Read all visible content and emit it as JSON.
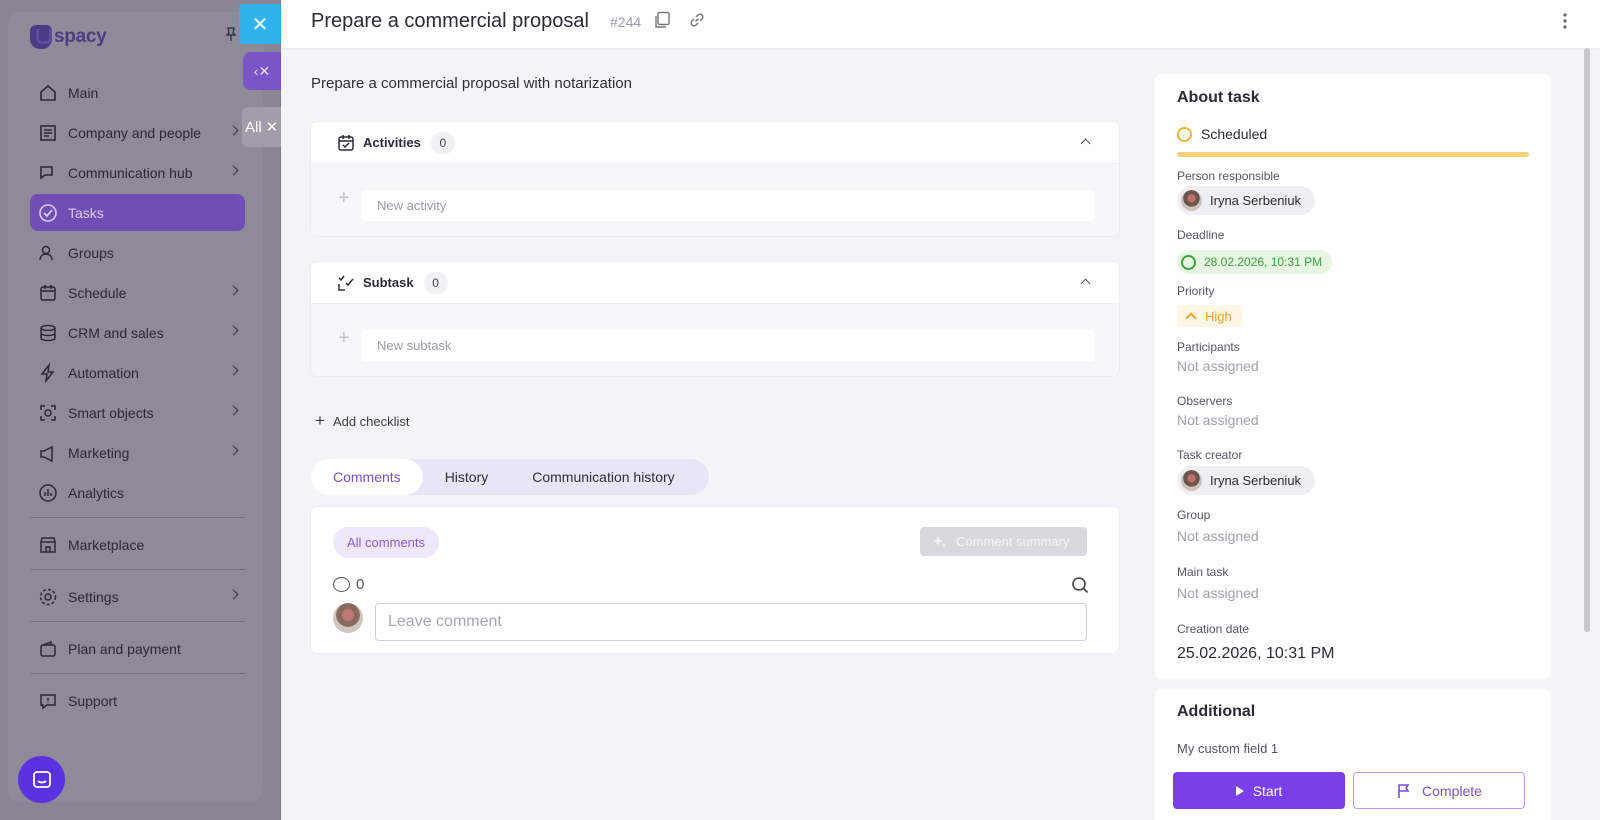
{
  "sidebar": {
    "logo_text": "spacy",
    "items": [
      {
        "label": "Main",
        "icon": "home-icon",
        "has_arrow": false
      },
      {
        "label": "Company and people",
        "icon": "company-icon",
        "has_arrow": true
      },
      {
        "label": "Communication hub",
        "icon": "chat-icon",
        "has_arrow": true
      },
      {
        "label": "Tasks",
        "icon": "tasks-icon",
        "has_arrow": false,
        "active": true
      },
      {
        "label": "Groups",
        "icon": "groups-icon",
        "has_arrow": false
      },
      {
        "label": "Schedule",
        "icon": "calendar-icon",
        "has_arrow": true
      },
      {
        "label": "CRM and sales",
        "icon": "database-icon",
        "has_arrow": true
      },
      {
        "label": "Automation",
        "icon": "lightning-icon",
        "has_arrow": true
      },
      {
        "label": "Smart objects",
        "icon": "smart-objects-icon",
        "has_arrow": true
      },
      {
        "label": "Marketing",
        "icon": "marketing-icon",
        "has_arrow": true
      },
      {
        "label": "Analytics",
        "icon": "analytics-icon",
        "has_arrow": false
      },
      {
        "label": "Marketplace",
        "icon": "store-icon",
        "has_arrow": false
      },
      {
        "label": "Settings",
        "icon": "gear-icon",
        "has_arrow": true
      },
      {
        "label": "Plan and payment",
        "icon": "wallet-icon",
        "has_arrow": false
      },
      {
        "label": "Support",
        "icon": "support-icon",
        "has_arrow": false
      }
    ]
  },
  "side_stack": {
    "close_glyph": "✕",
    "collapse_glyph": "‹✕",
    "all_label": "All"
  },
  "header": {
    "title": "Prepare a commercial proposal",
    "task_id": "#244"
  },
  "task": {
    "description": "Prepare a commercial proposal with notarization",
    "activities": {
      "label": "Activities",
      "count": "0",
      "placeholder": "New activity"
    },
    "subtask": {
      "label": "Subtask",
      "count": "0",
      "placeholder": "New subtask"
    },
    "add_checklist": "Add checklist"
  },
  "tabs": [
    {
      "label": "Comments",
      "active": true
    },
    {
      "label": "History",
      "active": false
    },
    {
      "label": "Communication history",
      "active": false
    }
  ],
  "comments": {
    "filter_label": "All comments",
    "summary_label": "Comment summary",
    "count": "0",
    "input_placeholder": "Leave comment"
  },
  "about": {
    "title": "About task",
    "status": "Scheduled",
    "person_responsible_label": "Person responsible",
    "person_responsible": "Iryna Serbeniuk",
    "deadline_label": "Deadline",
    "deadline": "28.02.2026, 10:31 PM",
    "priority_label": "Priority",
    "priority": "High",
    "participants_label": "Participants",
    "participants": "Not assigned",
    "observers_label": "Observers",
    "observers": "Not assigned",
    "creator_label": "Task creator",
    "creator": "Iryna Serbeniuk",
    "group_label": "Group",
    "group": "Not assigned",
    "main_task_label": "Main task",
    "main_task": "Not assigned",
    "creation_date_label": "Creation date",
    "creation_date": "25.02.2026, 10:31 PM"
  },
  "additional": {
    "title": "Additional",
    "field_label": "My custom field 1"
  },
  "actions": {
    "start_label": "Start",
    "complete_label": "Complete"
  },
  "colors": {
    "accent": "#7a3fe8",
    "status_scheduled": "#f0b53a",
    "deadline_green": "#3aa43a",
    "priority_high": "#f0a030",
    "close_blue": "#30b3ec"
  }
}
